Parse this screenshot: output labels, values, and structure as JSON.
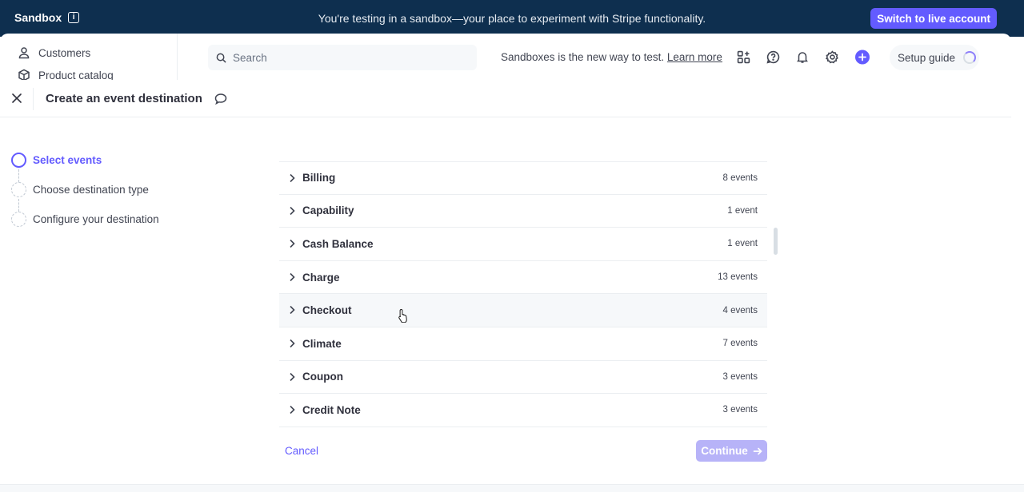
{
  "banner": {
    "title": "Sandbox",
    "message": "You're testing in a sandbox—your place to experiment with Stripe functionality.",
    "live_button": "Switch to live account"
  },
  "sidebar": {
    "items": [
      {
        "label": "Customers",
        "icon": "person-icon"
      },
      {
        "label": "Product catalog",
        "icon": "box-icon"
      }
    ]
  },
  "topbar": {
    "search_placeholder": "Search",
    "notice": "Sandboxes is the new way to test.",
    "notice_link": "Learn more",
    "setup_guide": "Setup guide"
  },
  "modal": {
    "title": "Create an event destination",
    "steps": [
      {
        "label": "Select events",
        "state": "active"
      },
      {
        "label": "Choose destination type",
        "state": "pending"
      },
      {
        "label": "Configure your destination",
        "state": "pending"
      }
    ],
    "events": [
      {
        "name": "Billing",
        "count": "8 events"
      },
      {
        "name": "Capability",
        "count": "1 event"
      },
      {
        "name": "Cash Balance",
        "count": "1 event"
      },
      {
        "name": "Charge",
        "count": "13 events"
      },
      {
        "name": "Checkout",
        "count": "4 events"
      },
      {
        "name": "Climate",
        "count": "7 events"
      },
      {
        "name": "Coupon",
        "count": "3 events"
      },
      {
        "name": "Credit Note",
        "count": "3 events"
      }
    ],
    "cancel_label": "Cancel",
    "continue_label": "Continue"
  },
  "colors": {
    "accent": "#635bff",
    "banner_bg": "#0e2f4f"
  }
}
